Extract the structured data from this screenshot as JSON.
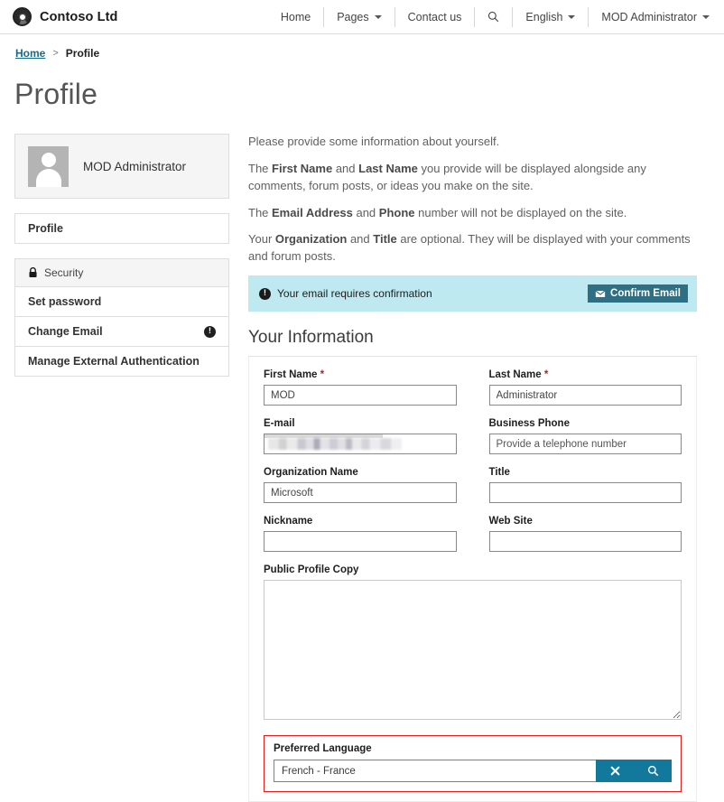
{
  "navbar": {
    "brand": "Contoso Ltd",
    "logo_icon": "contoso-swirl-logo",
    "items": [
      {
        "label": "Home",
        "icon": "",
        "caret": false
      },
      {
        "label": "Pages",
        "icon": "",
        "caret": true
      },
      {
        "label": "Contact us",
        "icon": "",
        "caret": false
      },
      {
        "label": "",
        "icon": "search-icon",
        "caret": false
      },
      {
        "label": "English",
        "icon": "",
        "caret": true
      },
      {
        "label": "MOD Administrator",
        "icon": "",
        "caret": true
      }
    ]
  },
  "breadcrumb": {
    "home": "Home",
    "separator": ">",
    "current": "Profile"
  },
  "page_title": "Profile",
  "sidebar": {
    "profile_card": {
      "name": "MOD Administrator",
      "avatar_icon": "user-avatar-placeholder"
    },
    "profile_link": "Profile",
    "security_group": {
      "header": "Security",
      "header_icon": "lock-icon",
      "rows": [
        {
          "label": "Set password",
          "badge": ""
        },
        {
          "label": "Change Email",
          "badge": "!"
        },
        {
          "label": "Manage External Authentication",
          "badge": ""
        }
      ]
    }
  },
  "intro": {
    "p1": "Please provide some information about yourself.",
    "p2_pre": "The ",
    "p2_b1": "First Name",
    "p2_mid": " and ",
    "p2_b2": "Last Name",
    "p2_post": " you provide will be displayed alongside any comments, forum posts, or ideas you make on the site.",
    "p3_pre": "The ",
    "p3_b1": "Email Address",
    "p3_mid": " and ",
    "p3_b2": "Phone",
    "p3_post": " number will not be displayed on the site.",
    "p4_pre": "Your ",
    "p4_b1": "Organization",
    "p4_mid": " and ",
    "p4_b2": "Title",
    "p4_post": " are optional. They will be displayed with your comments and forum posts."
  },
  "alert": {
    "icon": "exclamation-circle-icon",
    "message": "Your email requires confirmation",
    "button_label": "Confirm Email",
    "button_icon": "envelope-icon",
    "bg_color": "#bfe9f0",
    "button_color": "#2e6f84"
  },
  "form": {
    "section_title": "Your Information",
    "first_name": {
      "label": "First Name",
      "required": "*",
      "value": "MOD",
      "placeholder": ""
    },
    "last_name": {
      "label": "Last Name",
      "required": "*",
      "value": "Administrator",
      "placeholder": ""
    },
    "email": {
      "label": "E-mail",
      "value": "",
      "placeholder": "",
      "redacted": true
    },
    "business_phone": {
      "label": "Business Phone",
      "value": "",
      "placeholder": "Provide a telephone number"
    },
    "organization_name": {
      "label": "Organization Name",
      "value": "Microsoft",
      "placeholder": ""
    },
    "title": {
      "label": "Title",
      "value": "",
      "placeholder": ""
    },
    "nickname": {
      "label": "Nickname",
      "value": "",
      "placeholder": ""
    },
    "web_site": {
      "label": "Web Site",
      "value": "",
      "placeholder": ""
    },
    "public_profile_copy": {
      "label": "Public Profile Copy",
      "value": "",
      "placeholder": ""
    },
    "preferred_language": {
      "label": "Preferred Language",
      "value": "French - France",
      "placeholder": "",
      "clear_icon": "close-x-icon",
      "search_icon": "search-icon",
      "button_color": "#13799c",
      "highlight_color": "#e01b1b"
    }
  }
}
